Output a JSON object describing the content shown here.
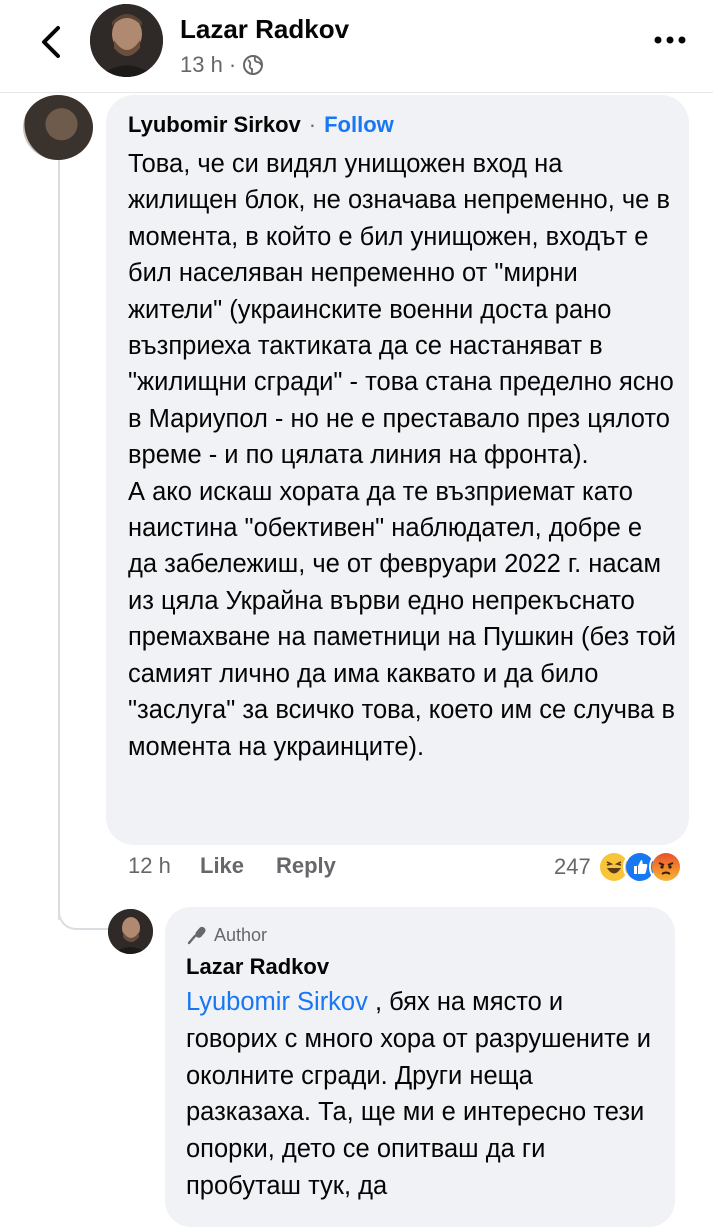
{
  "post": {
    "author": "Lazar Radkov",
    "time": "13 h",
    "separator": "·",
    "audience_icon": "globe-icon"
  },
  "comment": {
    "author": "Lyubomir Sirkov",
    "separator": "·",
    "follow_label": "Follow",
    "paragraph1": "Това, че си видял унищожен вход на жилищен блок, не означава непременно, че в момента, в който е бил унищожен, входът е бил населяван непременно от \"мирни жители\" (украинските военни доста рано възприеха тактиката да се настаняват в \"жилищни сгради\" - това стана пределно ясно в Мариупол - но не е преставало през цялото време - и по цялата линия на фронта).",
    "paragraph2": "А ако искаш хората да те възприемат като наистина \"обективен\" наблюдател, добре е да забележиш, че от февруари 2022 г. насам из цяла Украйна върви едно непрекъснато премахване на паметници на Пушкин (без той самият лично да има каквато и да било \"заслуга\" за всичко това, което им се случва в момента на украинците).",
    "time": "12 h",
    "like_label": "Like",
    "reply_label": "Reply",
    "reaction_count": "247",
    "reactions": [
      "haha-icon",
      "like-icon",
      "angry-icon"
    ]
  },
  "reply": {
    "badge": "Author",
    "author": "Lazar Radkov",
    "mention": "Lyubomir Sirkov",
    "text": " , бях на място и говорих с много хора от разрушените и околните сгради. Други неща разказаха. Та, ще ми е интересно тези опорки, дето се опитваш да ги пробуташ тук, да"
  },
  "colors": {
    "accent": "#1877f2",
    "bubble": "#f0f2f5",
    "muted": "#65676b"
  }
}
